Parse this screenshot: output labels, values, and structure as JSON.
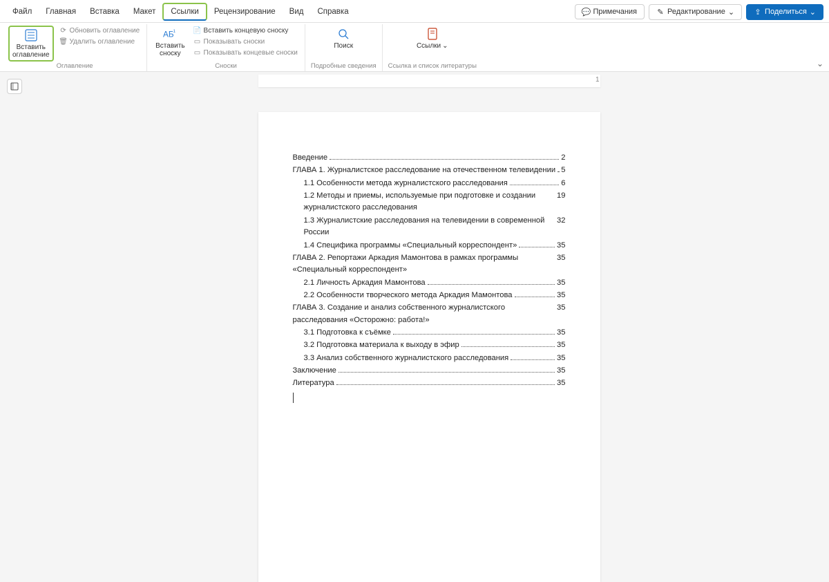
{
  "tabs": [
    "Файл",
    "Главная",
    "Вставка",
    "Макет",
    "Ссылки",
    "Рецензирование",
    "Вид",
    "Справка"
  ],
  "active_tab_index": 4,
  "right_buttons": {
    "comments": "Примечания",
    "edit_mode": "Редактирование",
    "share": "Поделиться"
  },
  "ribbon": {
    "group_toc": {
      "insert_toc": "Вставить\nоглавление",
      "update_toc": "Обновить оглавление",
      "delete_toc": "Удалить оглавление",
      "label": "Оглавление"
    },
    "group_footnotes": {
      "insert_footnote": "Вставить\nсноску",
      "insert_endnote": "Вставить концевую сноску",
      "show_footnotes": "Показывать сноски",
      "show_endnotes": "Показывать концевые сноски",
      "label": "Сноски"
    },
    "group_details": {
      "search": "Поиск",
      "label": "Подробные сведения"
    },
    "group_refs": {
      "links": "Ссылки",
      "label": "Ссылка и список литературы"
    }
  },
  "page_number": "1",
  "toc": [
    {
      "t": "Введение",
      "p": "2",
      "i": 0
    },
    {
      "t": "ГЛАВА 1.  Журналистское расследование на отечественном телевидении",
      "p": "5",
      "i": 0
    },
    {
      "t": "1.1 Особенности метода журналистского расследования",
      "p": "6",
      "i": 1
    },
    {
      "t": "1.2 Методы и приемы, используемые при подготовке и создании журналистского расследования",
      "p": "19",
      "i": 1
    },
    {
      "t": "1.3 Журналистские расследования на телевидении в современной России",
      "p": "32",
      "i": 1
    },
    {
      "t": "1.4 Специфика программы «Специальный корреспондент»",
      "p": "35",
      "i": 1
    },
    {
      "t": "ГЛАВА 2.  Репортажи Аркадия Мамонтова в рамках программы «Специальный корреспондент»",
      "p": "35",
      "i": 0
    },
    {
      "t": "2.1 Личность Аркадия Мамонтова",
      "p": "35",
      "i": 1
    },
    {
      "t": "2.2 Особенности творческого метода Аркадия Мамонтова",
      "p": "35",
      "i": 1
    },
    {
      "t": "ГЛАВА 3.  Создание и анализ собственного журналистского расследования «Осторожно: работа!»",
      "p": "35",
      "i": 0
    },
    {
      "t": "3.1 Подготовка к съёмке",
      "p": "35",
      "i": 1
    },
    {
      "t": "3.2 Подготовка материала к выходу в эфир",
      "p": "35",
      "i": 1
    },
    {
      "t": "3.3 Анализ собственного журналистского расследования",
      "p": "35",
      "i": 1
    },
    {
      "t": "Заключение",
      "p": "35",
      "i": 0
    },
    {
      "t": "Литература",
      "p": "35",
      "i": 0
    }
  ]
}
